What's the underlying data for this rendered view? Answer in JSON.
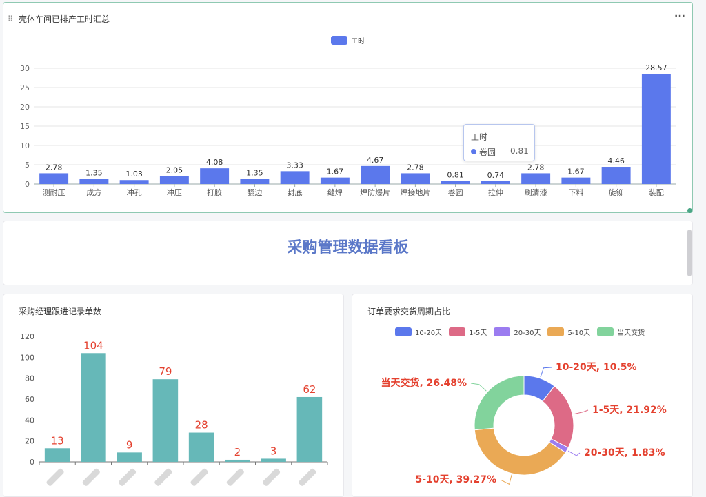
{
  "card1": {
    "title": "壳体车间已排产工时汇总",
    "more_label": "···",
    "legend": {
      "label": "工时",
      "color": "#5b78ec"
    },
    "tooltip": {
      "title": "工时",
      "name": "卷圆",
      "value": "0.81"
    }
  },
  "card2": {
    "title": "采购管理数据看板"
  },
  "card3": {
    "title": "采购经理跟进记录单数"
  },
  "card4": {
    "title": "订单要求交货周期占比"
  },
  "colors": {
    "bar_blue": "#5b78ec",
    "bar_teal": "#66b8b8",
    "label_red": "#e4412f"
  },
  "chart_data": [
    {
      "type": "bar",
      "series": [
        {
          "name": "工时",
          "values": [
            2.78,
            1.35,
            1.03,
            2.05,
            4.08,
            1.35,
            3.33,
            1.67,
            4.67,
            2.78,
            0.81,
            0.74,
            2.78,
            1.67,
            4.46,
            28.57
          ]
        }
      ],
      "categories": [
        "测耐压",
        "成方",
        "冲孔",
        "冲压",
        "打胶",
        "翻边",
        "封底",
        "缝焊",
        "焊防爆片",
        "焊接地片",
        "卷圆",
        "拉伸",
        "刷清漆",
        "下料",
        "旋铆",
        "装配"
      ],
      "value_labels": [
        "2.78",
        "1.35",
        "1.03",
        "2.05",
        "4.08",
        "1.35",
        "3.33",
        "1.67",
        "4.67",
        "2.78",
        "0.81",
        "0.74",
        "2.78",
        "1.67",
        "4.46",
        "28.57"
      ],
      "ylim": [
        0,
        30
      ],
      "yticks": [
        "0",
        "5",
        "10",
        "15",
        "20",
        "25",
        "30"
      ],
      "grid": true,
      "legend": "top-center"
    },
    {
      "type": "bar",
      "categories": [
        "",
        "",
        "",
        "",
        "",
        "",
        "",
        ""
      ],
      "values": [
        13,
        104,
        9,
        79,
        28,
        2,
        3,
        62
      ],
      "value_labels": [
        "13",
        "104",
        "9",
        "79",
        "28",
        "2",
        "3",
        "62"
      ],
      "ylim": [
        0,
        120
      ],
      "yticks": [
        "0",
        "20",
        "40",
        "60",
        "80",
        "100",
        "120"
      ],
      "grid": false
    },
    {
      "type": "pie",
      "slices": [
        {
          "name": "10-20天",
          "value": 10.5,
          "label": "10-20天, 10.5%",
          "color": "#5b78ec"
        },
        {
          "name": "1-5天",
          "value": 21.92,
          "label": "1-5天, 21.92%",
          "color": "#dd6a86"
        },
        {
          "name": "20-30天",
          "value": 1.83,
          "label": "20-30天, 1.83%",
          "color": "#9b7cf0"
        },
        {
          "name": "5-10天",
          "value": 39.27,
          "label": "5-10天, 39.27%",
          "color": "#eaa955"
        },
        {
          "name": "当天交货",
          "value": 26.48,
          "label": "当天交货, 26.48%",
          "color": "#82d39c"
        }
      ],
      "legend": "top-center",
      "donut": true
    }
  ]
}
